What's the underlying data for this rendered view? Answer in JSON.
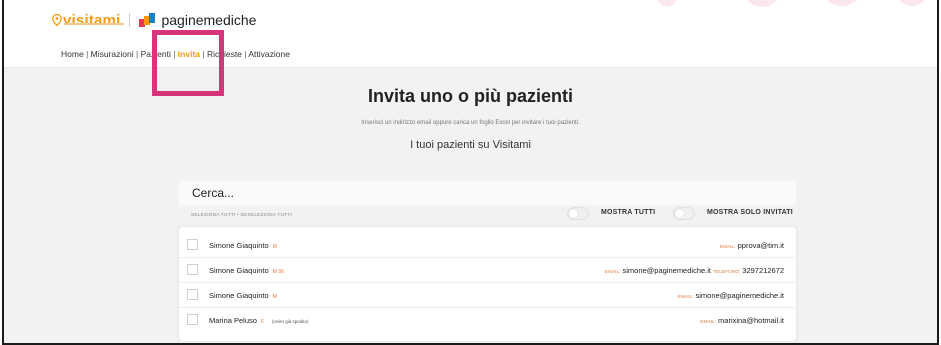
{
  "header": {
    "brand_visitami": "visitami",
    "brand_pagine": "paginemediche"
  },
  "nav": {
    "items": [
      {
        "label": "Home"
      },
      {
        "label": "Misurazioni"
      },
      {
        "label": "Pazienti"
      },
      {
        "label": "Invita"
      },
      {
        "label": "Richieste"
      },
      {
        "label": "Attivazione"
      }
    ],
    "separator": "|",
    "active": "Invita"
  },
  "main": {
    "title": "Invita uno o più pazienti",
    "subtitle": "Inserisci un indirizzo email oppure carica un foglio Excel per invitare i tuoi pazienti.",
    "section_title": "I tuoi pazienti su Visitami"
  },
  "search": {
    "placeholder": "Cerca..."
  },
  "selection": {
    "select_all": "SELEZIONA TUTTI",
    "divider": "•",
    "deselect_all": "DESELEZIONA TUTTI"
  },
  "filters": {
    "show_all": "MOSTRA TUTTI",
    "show_invited": "MOSTRA SOLO INVITATI"
  },
  "labels": {
    "email": "EMAIL:",
    "phone": "TELEFONO:"
  },
  "patients": [
    {
      "name": "Simone Giaquinto",
      "gender": "M",
      "note": "",
      "email": "pprova@tim.it",
      "phone": ""
    },
    {
      "name": "Simone Giaquinto",
      "gender": "M 36",
      "note": "",
      "email": "simone@paginemediche.it",
      "phone": "3297212672"
    },
    {
      "name": "Simone Giaquinto",
      "gender": "M",
      "note": "",
      "email": "simone@paginemediche.it",
      "phone": ""
    },
    {
      "name": "Marina Peluso",
      "gender": "F",
      "note": "(invito già spedito)",
      "email": "marixina@hotmail.it",
      "phone": ""
    }
  ],
  "colors": {
    "accent": "#f39c12",
    "highlight_box": "#d8347c",
    "label_orange": "#e07b39"
  },
  "icons": {
    "visitami_logo": "location-pin-icon",
    "paginemediche_logo": "paginemediche-logo-icon"
  }
}
